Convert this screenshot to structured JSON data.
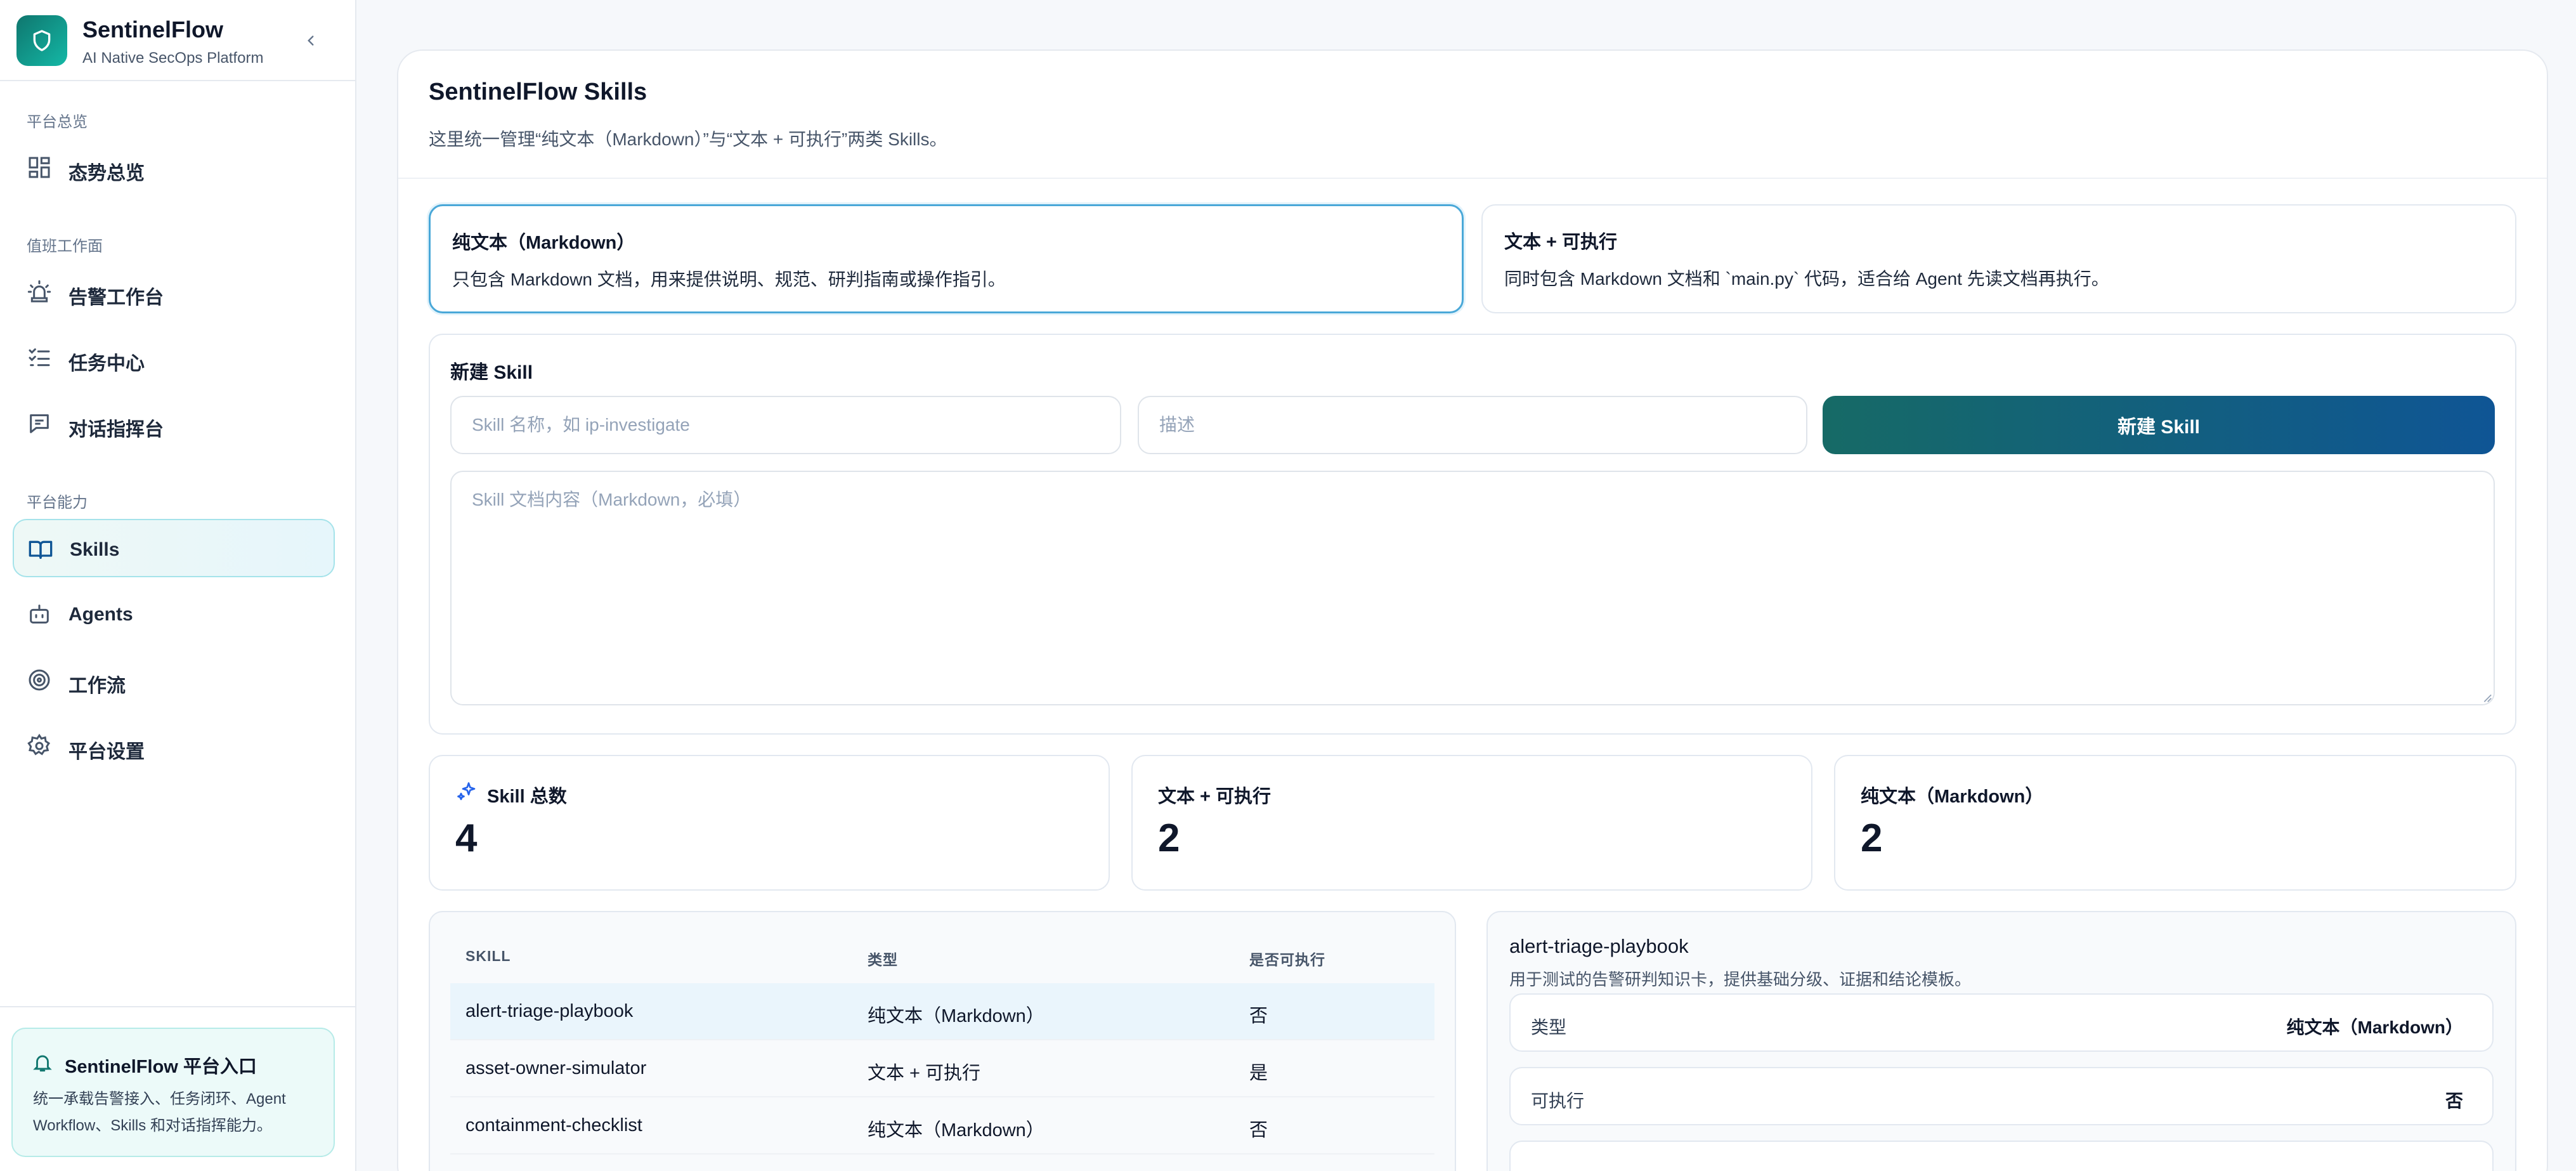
{
  "brand": {
    "name": "SentinelFlow",
    "subtitle": "AI Native SecOps Platform"
  },
  "sidebar": {
    "sections": [
      {
        "title": "平台总览"
      },
      {
        "title": "值班工作面"
      },
      {
        "title": "平台能力"
      }
    ],
    "items": [
      {
        "label": "态势总览",
        "icon": "dashboard-grid-icon"
      },
      {
        "label": "告警工作台",
        "icon": "alarm-siren-icon"
      },
      {
        "label": "任务中心",
        "icon": "checklist-icon"
      },
      {
        "label": "对话指挥台",
        "icon": "chat-message-icon"
      },
      {
        "label": "Skills",
        "icon": "book-open-icon",
        "active": true
      },
      {
        "label": "Agents",
        "icon": "bot-icon"
      },
      {
        "label": "工作流",
        "icon": "radar-target-icon"
      },
      {
        "label": "平台设置",
        "icon": "gear-icon"
      }
    ],
    "promo": {
      "title": "SentinelFlow 平台入口",
      "body": "统一承载告警接入、任务闭环、Agent Workflow、Skills 和对话指挥能力。"
    }
  },
  "page": {
    "title": "SentinelFlow Skills",
    "description": "这里统一管理“纯文本（Markdown）”与“文本 + 可执行”两类 Skills。"
  },
  "skill_types": [
    {
      "title": "纯文本（Markdown）",
      "desc": "只包含 Markdown 文档，用来提供说明、规范、研判指南或操作指引。",
      "selected": true
    },
    {
      "title": "文本 + 可执行",
      "desc": "同时包含 Markdown 文档和 `main.py` 代码，适合给 Agent 先读文档再执行。",
      "selected": false
    }
  ],
  "new_skill": {
    "title": "新建 Skill",
    "name_placeholder": "Skill 名称，如 ip-investigate",
    "desc_placeholder": "描述",
    "content_placeholder": "Skill 文档内容（Markdown，必填）",
    "button": "新建 Skill"
  },
  "stats": [
    {
      "label": "Skill 总数",
      "value": "4"
    },
    {
      "label": "文本 + 可执行",
      "value": "2"
    },
    {
      "label": "纯文本（Markdown）",
      "value": "2"
    }
  ],
  "table": {
    "headers": [
      "SKILL",
      "类型",
      "是否可执行"
    ],
    "rows": [
      {
        "name": "alert-triage-playbook",
        "type": "纯文本（Markdown）",
        "exec": "否",
        "selected": true
      },
      {
        "name": "asset-owner-simulator",
        "type": "文本 + 可执行",
        "exec": "是"
      },
      {
        "name": "containment-checklist",
        "type": "纯文本（Markdown）",
        "exec": "否"
      }
    ]
  },
  "detail": {
    "title": "alert-triage-playbook",
    "desc": "用于测试的告警研判知识卡，提供基础分级、证据和结论模板。",
    "fields": [
      {
        "key": "类型",
        "value": "纯文本（Markdown）"
      },
      {
        "key": "可执行",
        "value": "否"
      }
    ]
  },
  "colors": {
    "accent": "#0f766e",
    "button_gradient_start": "#166a66",
    "button_gradient_end": "#0f5595",
    "selected_border": "#4aa8d8",
    "active_nav_bg": "#eef8f6"
  }
}
